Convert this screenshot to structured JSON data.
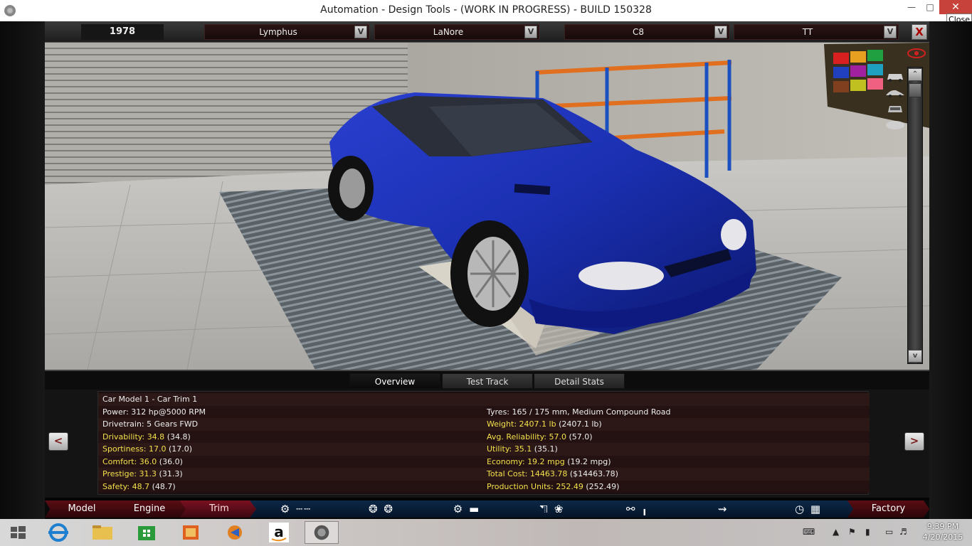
{
  "window": {
    "title": "Automation - Design Tools - (WORK IN PROGRESS) - BUILD 150328",
    "close_tooltip": "Close"
  },
  "topbar": {
    "year": "1978",
    "selectors": [
      {
        "label": "Lymphus",
        "btn": "V"
      },
      {
        "label": "LaNore",
        "btn": "V"
      },
      {
        "label": "C8",
        "btn": "V"
      },
      {
        "label": "TT",
        "btn": "V"
      }
    ],
    "close_label": "X"
  },
  "tabs": [
    "Overview",
    "Test Track",
    "Detail Stats"
  ],
  "stats": {
    "title": "Car Model 1 - Car Trim 1",
    "left": [
      {
        "label": "Power:",
        "value": "312 hp@5000 RPM",
        "extra": "",
        "highlight": false
      },
      {
        "label": "Drivetrain:",
        "value": "5 Gears FWD",
        "extra": "",
        "highlight": false
      },
      {
        "label": "Drivability:",
        "value": "34.8",
        "extra": "(34.8)",
        "highlight": true
      },
      {
        "label": "Sportiness:",
        "value": "17.0",
        "extra": "(17.0)",
        "highlight": true
      },
      {
        "label": "Comfort:",
        "value": "36.0",
        "extra": "(36.0)",
        "highlight": true
      },
      {
        "label": "Prestige:",
        "value": "31.3",
        "extra": "(31.3)",
        "highlight": true
      },
      {
        "label": "Safety:",
        "value": "48.7",
        "extra": "(48.7)",
        "highlight": true
      }
    ],
    "right": [
      {
        "label": "Tyres:",
        "value": "165 / 175 mm, Medium Compound Road",
        "extra": "",
        "highlight": false
      },
      {
        "label": "Weight:",
        "value": "2407.1 lb",
        "extra": "(2407.1 lb)",
        "highlight": true
      },
      {
        "label": "Avg. Reliability:",
        "value": "57.0",
        "extra": "(57.0)",
        "highlight": true
      },
      {
        "label": "Utility:",
        "value": "35.1",
        "extra": "(35.1)",
        "highlight": true
      },
      {
        "label": "Economy:",
        "value": "19.2 mpg",
        "extra": "(19.2 mpg)",
        "highlight": true
      },
      {
        "label": "Total Cost:",
        "value": "14463.78",
        "extra": "($14463.78)",
        "highlight": true
      },
      {
        "label": "Production Units:",
        "value": "252.49",
        "extra": "(252.49)",
        "highlight": true
      }
    ],
    "prev_label": "<",
    "next_label": ">"
  },
  "nav": [
    {
      "label": "Model",
      "style": "red",
      "icon": ""
    },
    {
      "label": "Engine",
      "style": "red",
      "icon": ""
    },
    {
      "label": "Trim",
      "style": "active",
      "icon": ""
    },
    {
      "label": "",
      "style": "blue",
      "icon": "gearbox-icon"
    },
    {
      "label": "",
      "style": "blue",
      "icon": "wheels-icon"
    },
    {
      "label": "",
      "style": "blue",
      "icon": "suspension-icon"
    },
    {
      "label": "",
      "style": "blue",
      "icon": "body-aero-icon"
    },
    {
      "label": "",
      "style": "blue",
      "icon": "interior-icon"
    },
    {
      "label": "",
      "style": "blue",
      "icon": "fixtures-icon"
    },
    {
      "label": "",
      "style": "blue",
      "icon": "test-drive-icon"
    },
    {
      "label": "Factory",
      "style": "red",
      "icon": ""
    }
  ],
  "taskbar": {
    "time": "9:39 PM",
    "date": "4/20/2015"
  },
  "colors": {
    "car_body": "#1a2fb0",
    "accent_red": "#5a0d14",
    "accent_blue": "#0c2848",
    "stat_highlight": "#f2e04a"
  }
}
